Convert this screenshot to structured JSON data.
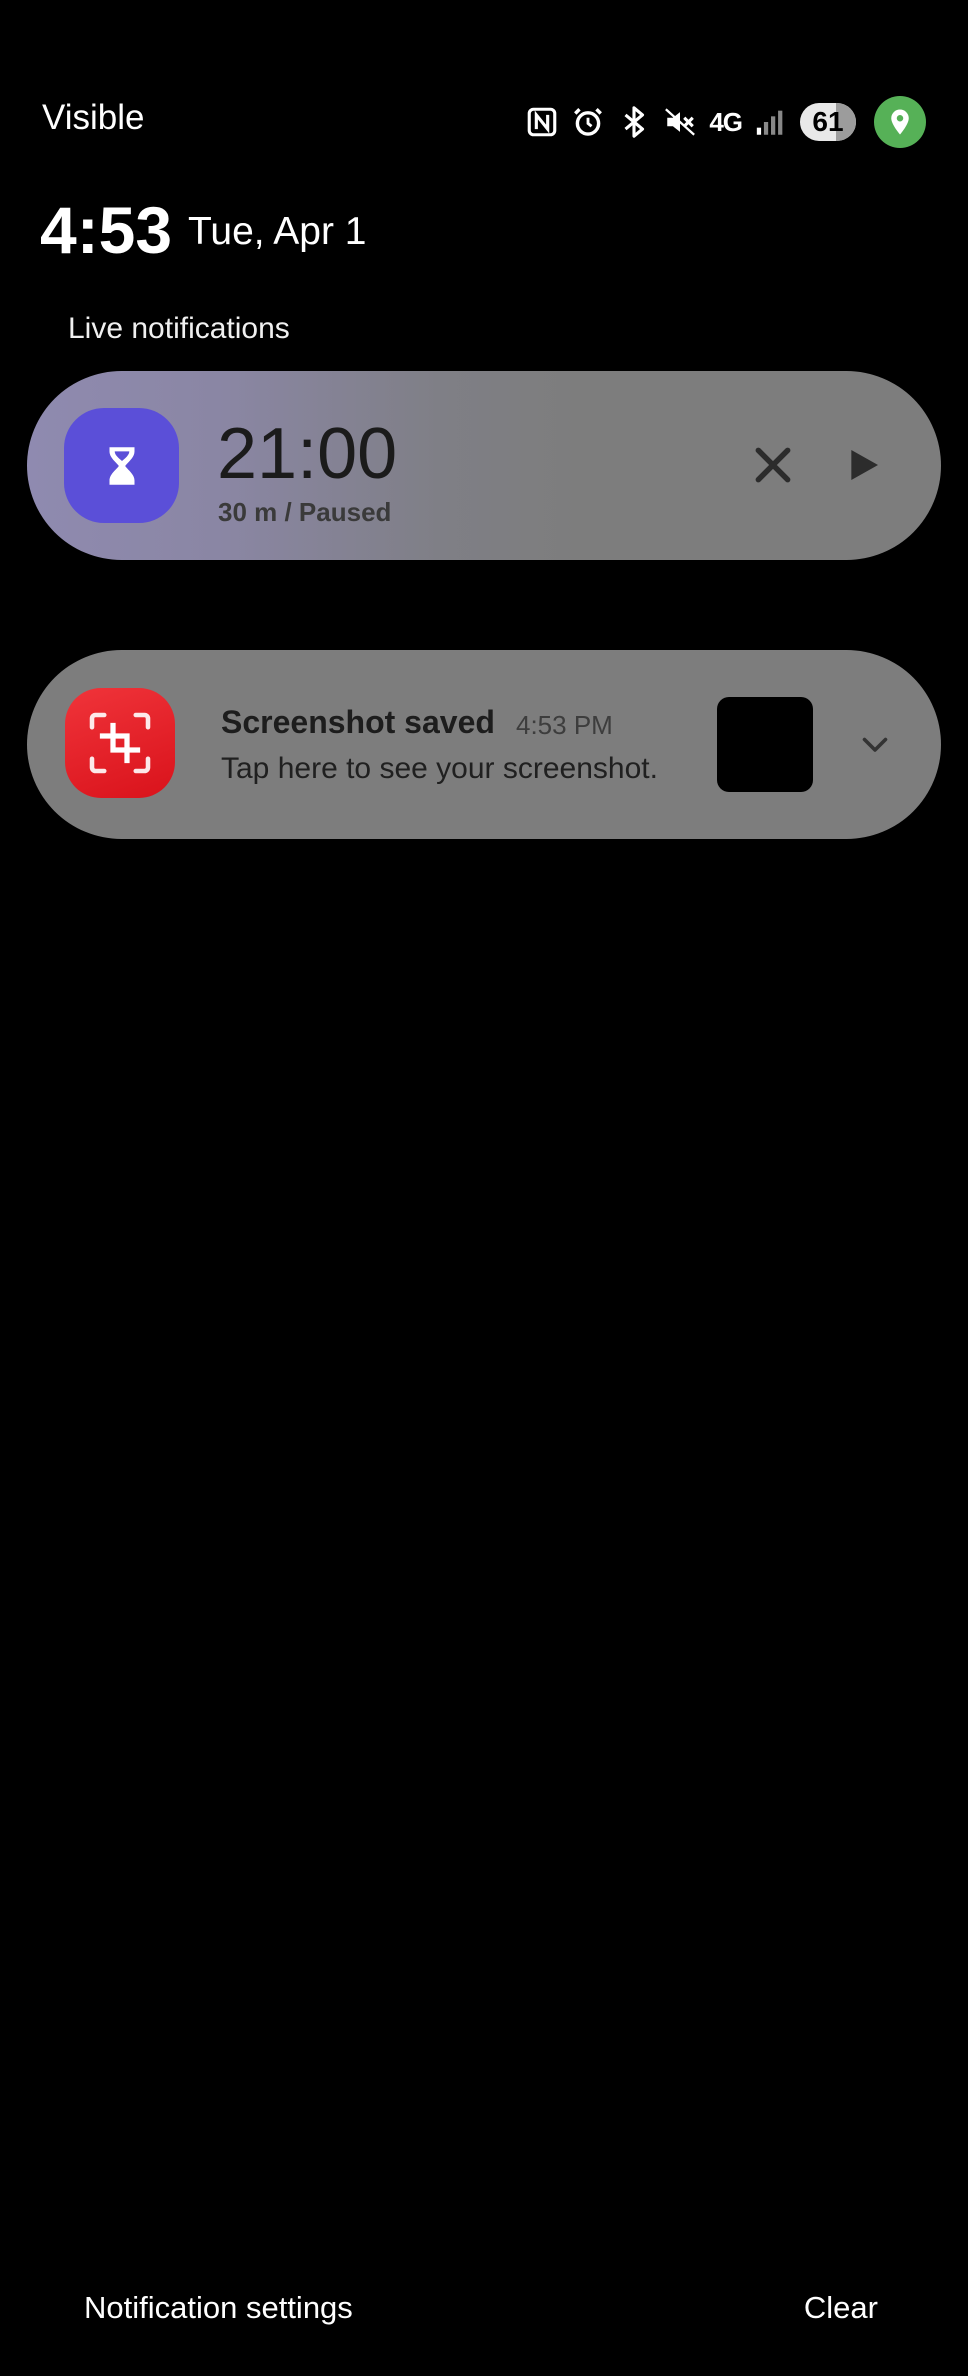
{
  "status_bar": {
    "carrier": "Visible",
    "icons": [
      "nfc-icon",
      "alarm-icon",
      "bluetooth-icon",
      "mute-icon",
      "4g-lte-icon",
      "signal-icon",
      "battery-icon",
      "location-icon"
    ],
    "network": "4G",
    "battery_level": "61"
  },
  "header": {
    "time": "4:53",
    "date": "Tue, Apr 1"
  },
  "live_notifications": {
    "label": "Live notifications",
    "timer": {
      "app_icon": "hourglass-icon",
      "time": "21:00",
      "status": "30 m / Paused",
      "accent_color": "#5b4fd8"
    }
  },
  "notifications": [
    {
      "app_icon": "screenshot-crop-icon",
      "title": "Screenshot saved",
      "time": "4:53 PM",
      "body": "Tap here to see your screenshot.",
      "accent_color": "#e8232a"
    }
  ],
  "footer": {
    "settings_label": "Notification settings",
    "clear_label": "Clear"
  }
}
